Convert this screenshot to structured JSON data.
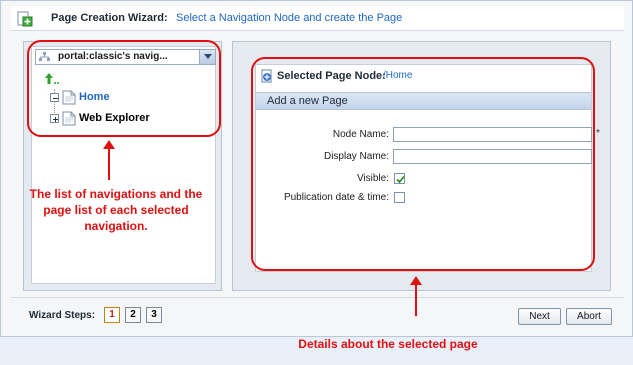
{
  "wizard": {
    "title": "Page Creation Wizard:",
    "description": "Select a Navigation Node and create the Page"
  },
  "navigation": {
    "selected": "portal:classic's navig...",
    "nodes": [
      {
        "label": "Home",
        "color": "#1f67c6"
      },
      {
        "label": "Web Explorer",
        "color": "#111111"
      }
    ]
  },
  "page_node": {
    "label": "Selected Page Node:",
    "value": "/Home",
    "section_title": "Add a new Page",
    "fields": {
      "node_name": {
        "label": "Node Name:",
        "value": "",
        "required_mark": "*"
      },
      "display_name": {
        "label": "Display Name:",
        "value": ""
      },
      "visible": {
        "label": "Visible:",
        "checked": true
      },
      "publication": {
        "label": "Publication date & time:",
        "checked": false
      }
    }
  },
  "steps": {
    "label": "Wizard Steps:",
    "items": [
      "1",
      "2",
      "3"
    ],
    "active": "1"
  },
  "buttons": {
    "next": "Next",
    "abort": "Abort"
  },
  "annotations": {
    "left": "The list of navigations and the page list of each selected navigation.",
    "bottom": "Details about the selected page",
    "color": "#e01010"
  }
}
